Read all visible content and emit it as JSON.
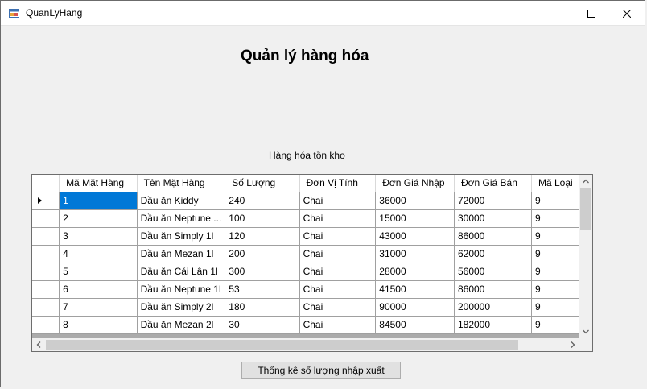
{
  "window": {
    "title": "QuanLyHang"
  },
  "form": {
    "heading": "Quản lý hàng hóa",
    "grid_caption": "Hàng hóa tồn kho",
    "stats_button": "Thống kê số lượng nhập xuất"
  },
  "grid": {
    "columns": [
      "Mã Mặt Hàng",
      "Tên Mặt Hàng",
      "Số Lượng",
      "Đơn Vị Tính",
      "Đơn Giá Nhập",
      "Đơn Giá Bán",
      "Mã Loại"
    ],
    "rows": [
      [
        "1",
        "Dầu ăn Kiddy",
        "240",
        "Chai",
        "36000",
        "72000",
        "9"
      ],
      [
        "2",
        "Dầu ăn Neptune ...",
        "100",
        "Chai",
        "15000",
        "30000",
        "9"
      ],
      [
        "3",
        "Dầu ăn Simply 1l",
        "120",
        "Chai",
        "43000",
        "86000",
        "9"
      ],
      [
        "4",
        "Dầu ăn Mezan 1l",
        "200",
        "Chai",
        "31000",
        "62000",
        "9"
      ],
      [
        "5",
        "Dầu ăn Cái Lân 1l",
        "300",
        "Chai",
        "28000",
        "56000",
        "9"
      ],
      [
        "6",
        "Dầu ăn Neptune 1l",
        "53",
        "Chai",
        "41500",
        "86000",
        "9"
      ],
      [
        "7",
        "Dầu ăn Simply 2l",
        "180",
        "Chai",
        "90000",
        "200000",
        "9"
      ],
      [
        "8",
        "Dầu ăn Mezan 2l",
        "30",
        "Chai",
        "84500",
        "182000",
        "9"
      ]
    ],
    "selected_row": 0,
    "selected_column": 0
  },
  "colors": {
    "selection": "#0078d7",
    "window_bg": "#f0f0f0",
    "grid_bg": "#ababab"
  },
  "icons": [
    "app-icon",
    "minimize-icon",
    "maximize-icon",
    "close-icon",
    "current-row-arrow-icon",
    "scroll-up-icon",
    "scroll-down-icon",
    "scroll-left-icon",
    "scroll-right-icon"
  ]
}
